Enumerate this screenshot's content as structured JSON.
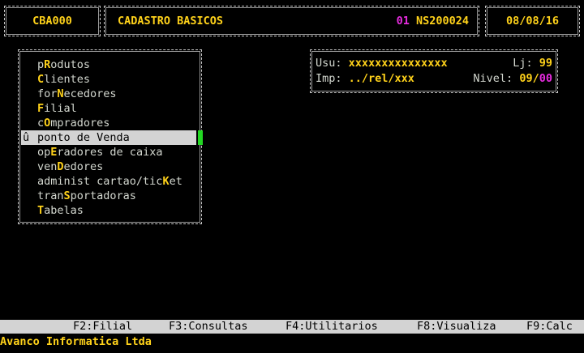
{
  "header": {
    "program_code": "CBA000",
    "title": "CADASTRO BASICOS",
    "company_code": "01",
    "station": "NS200024",
    "date": "08/08/16"
  },
  "menu": {
    "items": [
      {
        "pre": "p",
        "key": "R",
        "post": "odutos"
      },
      {
        "pre": "",
        "key": "C",
        "post": "lientes"
      },
      {
        "pre": "for",
        "key": "N",
        "post": "ecedores"
      },
      {
        "pre": "",
        "key": "F",
        "post": "ilial"
      },
      {
        "pre": "c",
        "key": "O",
        "post": "mpradores"
      },
      {
        "pre": "ponto de ",
        "key": "V",
        "post": "enda",
        "selected": true,
        "mark": "û"
      },
      {
        "pre": "op",
        "key": "E",
        "post": "radores de caixa"
      },
      {
        "pre": "ven",
        "key": "D",
        "post": "edores"
      },
      {
        "pre": "administ cartao/tic",
        "key": "K",
        "post": "et"
      },
      {
        "pre": "tran",
        "key": "S",
        "post": "portadoras"
      },
      {
        "pre": "",
        "key": "T",
        "post": "abelas"
      }
    ]
  },
  "info": {
    "user_label": "Usu:",
    "user_value": "xxxxxxxxxxxxxxx",
    "store_label": "Lj:",
    "store_value": "99",
    "printer_label": "Imp:",
    "printer_value": "../rel/xxx",
    "level_label": "Nivel:",
    "level_value": "09",
    "level_sep": "/",
    "level_max": "00"
  },
  "function_keys": [
    {
      "label": "F2:Filial"
    },
    {
      "label": "F3:Consultas"
    },
    {
      "label": "F4:Utilitarios"
    },
    {
      "label": "F8:Visualiza"
    },
    {
      "label": "F9:Calc"
    }
  ],
  "footer": {
    "company": "Avanco Informatica Ltda"
  },
  "colors": {
    "background": "#000000",
    "highlight": "#ffd21a",
    "accent": "#e82ce0",
    "selection": "#d3d3d3",
    "cursor": "#22d822"
  }
}
